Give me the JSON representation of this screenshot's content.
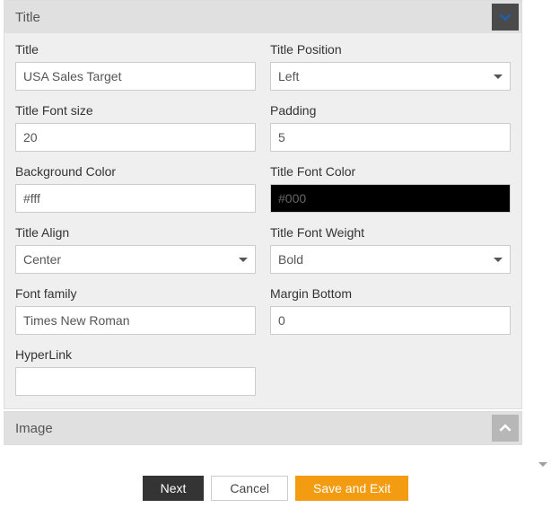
{
  "sections": {
    "title": {
      "header": "Title",
      "fields": {
        "title": {
          "label": "Title",
          "value": "USA Sales Target"
        },
        "titlePosition": {
          "label": "Title Position",
          "value": "Left"
        },
        "titleFontSize": {
          "label": "Title Font size",
          "value": "20"
        },
        "padding": {
          "label": "Padding",
          "value": "5"
        },
        "backgroundColor": {
          "label": "Background Color",
          "value": "#fff"
        },
        "titleFontColor": {
          "label": "Title Font Color",
          "value": "#000"
        },
        "titleAlign": {
          "label": "Title Align",
          "value": "Center"
        },
        "titleFontWeight": {
          "label": "Title Font Weight",
          "value": "Bold"
        },
        "fontFamily": {
          "label": "Font family",
          "value": "Times New Roman"
        },
        "marginBottom": {
          "label": "Margin Bottom",
          "value": "0"
        },
        "hyperLink": {
          "label": "HyperLink",
          "value": ""
        }
      }
    },
    "image": {
      "header": "Image"
    }
  },
  "footer": {
    "next": "Next",
    "cancel": "Cancel",
    "saveExit": "Save and Exit"
  }
}
